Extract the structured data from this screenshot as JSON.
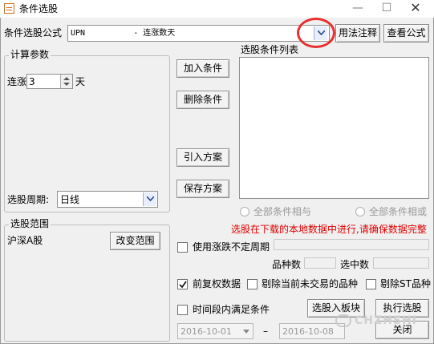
{
  "window": {
    "title": "条件选股"
  },
  "formula": {
    "label": "条件选股公式",
    "selected": "UPN          - 连涨数天",
    "usage_button": "用法注释",
    "view_button": "查看公式"
  },
  "params": {
    "legend": "计算参数",
    "lianzhang_label": "连涨",
    "lianzhang_value": "3",
    "unit": "天",
    "period_label": "选股周期:",
    "period_value": "日线"
  },
  "actions": {
    "add": "加入条件",
    "delete": "删除条件",
    "import": "引入方案",
    "save": "保存方案"
  },
  "conditions": {
    "title": "选股条件列表",
    "radio_and": "全部条件相与",
    "radio_or": "全部条件相或",
    "warning": "选股在下载的本地数据中进行,请确保数据完整"
  },
  "range": {
    "legend": "选股范围",
    "value": "沪深A股",
    "change_button": "改变范围"
  },
  "options": {
    "variable_period": "使用涨跌不定周期",
    "count_label": "品种数",
    "selected_label": "选中数",
    "forward_adjust": "前复权数据",
    "exclude_untraded": "剔除当前未交易的品种",
    "exclude_st": "剔除ST品种",
    "time_range": "时间段内满足条件"
  },
  "bottom": {
    "add_to_board": "选股入板块",
    "execute": "执行选股",
    "close": "关闭",
    "date_from": "2016-10-01",
    "date_sep": "–",
    "date_to": "2016-10-08"
  },
  "watermark": "CHZHSHI",
  "colors": {
    "accent_red": "#e83030",
    "warning_red": "#e00000"
  }
}
